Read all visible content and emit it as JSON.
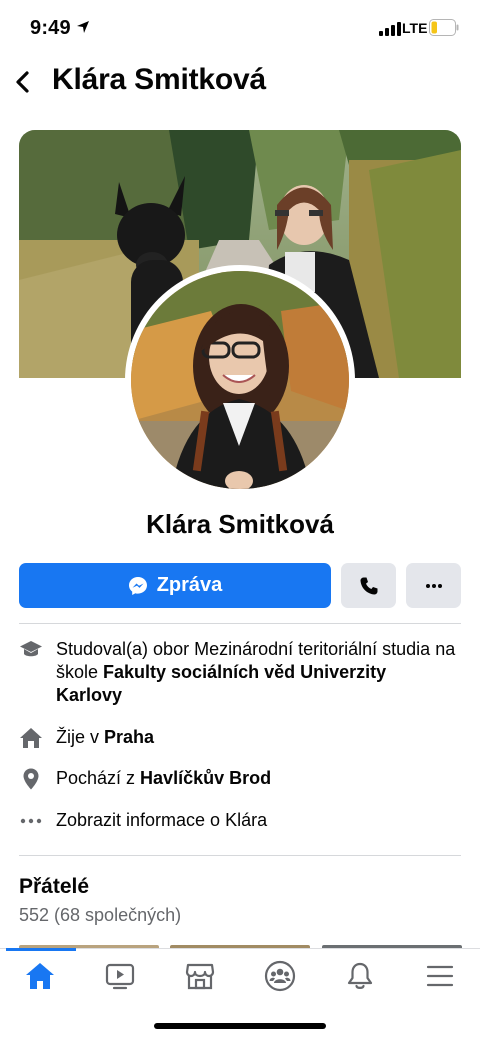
{
  "status_bar": {
    "time": "9:49",
    "network": "LTE",
    "battery_level": 0.25
  },
  "header": {
    "title": "Klára Smitková",
    "back_icon": "chevron-left-icon"
  },
  "profile": {
    "name": "Klára Smitková"
  },
  "actions": {
    "message_label": "Zpráva",
    "message_icon": "messenger-icon",
    "call_icon": "phone-icon",
    "more_icon": "more-dots-icon"
  },
  "info": {
    "education_prefix": "Studoval(a) obor Mezinárodní teritoriální studia na škole ",
    "education_school": "Fakulty sociálních věd Univerzity Karlovy",
    "lives_prefix": "Žije v ",
    "lives_city": "Praha",
    "from_prefix": "Pochází z ",
    "from_city": "Havlíčkův Brod",
    "show_info": "Zobrazit informace o Klára"
  },
  "friends": {
    "title": "Přátelé",
    "count": "552 (68 společných)"
  },
  "tabs": [
    {
      "name": "home",
      "icon": "home-icon",
      "active": true
    },
    {
      "name": "watch",
      "icon": "video-icon",
      "active": false
    },
    {
      "name": "marketplace",
      "icon": "shop-icon",
      "active": false
    },
    {
      "name": "groups",
      "icon": "groups-icon",
      "active": false
    },
    {
      "name": "notifications",
      "icon": "bell-icon",
      "active": false
    },
    {
      "name": "menu",
      "icon": "menu-icon",
      "active": false
    }
  ],
  "colors": {
    "accent": "#1877f2",
    "secondary_button": "#e4e6eb",
    "muted_text": "#65676b"
  }
}
